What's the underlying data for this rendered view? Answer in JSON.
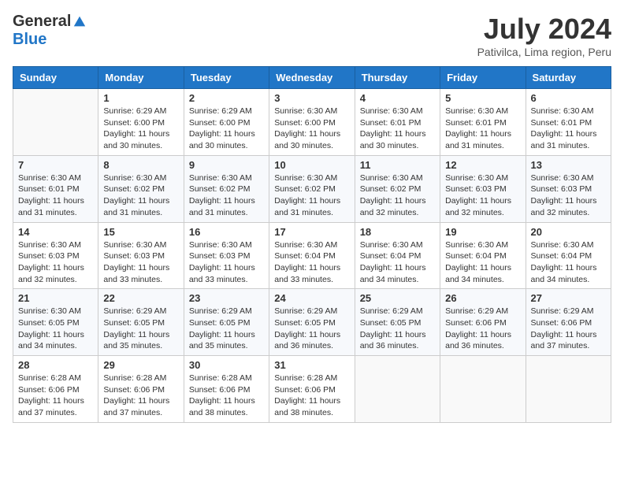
{
  "header": {
    "logo_general": "General",
    "logo_blue": "Blue",
    "month_title": "July 2024",
    "location": "Pativilca, Lima region, Peru"
  },
  "days_of_week": [
    "Sunday",
    "Monday",
    "Tuesday",
    "Wednesday",
    "Thursday",
    "Friday",
    "Saturday"
  ],
  "weeks": [
    [
      {
        "day": "",
        "sunrise": "",
        "sunset": "",
        "daylight": ""
      },
      {
        "day": "1",
        "sunrise": "Sunrise: 6:29 AM",
        "sunset": "Sunset: 6:00 PM",
        "daylight": "Daylight: 11 hours and 30 minutes."
      },
      {
        "day": "2",
        "sunrise": "Sunrise: 6:29 AM",
        "sunset": "Sunset: 6:00 PM",
        "daylight": "Daylight: 11 hours and 30 minutes."
      },
      {
        "day": "3",
        "sunrise": "Sunrise: 6:30 AM",
        "sunset": "Sunset: 6:00 PM",
        "daylight": "Daylight: 11 hours and 30 minutes."
      },
      {
        "day": "4",
        "sunrise": "Sunrise: 6:30 AM",
        "sunset": "Sunset: 6:01 PM",
        "daylight": "Daylight: 11 hours and 30 minutes."
      },
      {
        "day": "5",
        "sunrise": "Sunrise: 6:30 AM",
        "sunset": "Sunset: 6:01 PM",
        "daylight": "Daylight: 11 hours and 31 minutes."
      },
      {
        "day": "6",
        "sunrise": "Sunrise: 6:30 AM",
        "sunset": "Sunset: 6:01 PM",
        "daylight": "Daylight: 11 hours and 31 minutes."
      }
    ],
    [
      {
        "day": "7",
        "sunrise": "Sunrise: 6:30 AM",
        "sunset": "Sunset: 6:01 PM",
        "daylight": "Daylight: 11 hours and 31 minutes."
      },
      {
        "day": "8",
        "sunrise": "Sunrise: 6:30 AM",
        "sunset": "Sunset: 6:02 PM",
        "daylight": "Daylight: 11 hours and 31 minutes."
      },
      {
        "day": "9",
        "sunrise": "Sunrise: 6:30 AM",
        "sunset": "Sunset: 6:02 PM",
        "daylight": "Daylight: 11 hours and 31 minutes."
      },
      {
        "day": "10",
        "sunrise": "Sunrise: 6:30 AM",
        "sunset": "Sunset: 6:02 PM",
        "daylight": "Daylight: 11 hours and 31 minutes."
      },
      {
        "day": "11",
        "sunrise": "Sunrise: 6:30 AM",
        "sunset": "Sunset: 6:02 PM",
        "daylight": "Daylight: 11 hours and 32 minutes."
      },
      {
        "day": "12",
        "sunrise": "Sunrise: 6:30 AM",
        "sunset": "Sunset: 6:03 PM",
        "daylight": "Daylight: 11 hours and 32 minutes."
      },
      {
        "day": "13",
        "sunrise": "Sunrise: 6:30 AM",
        "sunset": "Sunset: 6:03 PM",
        "daylight": "Daylight: 11 hours and 32 minutes."
      }
    ],
    [
      {
        "day": "14",
        "sunrise": "Sunrise: 6:30 AM",
        "sunset": "Sunset: 6:03 PM",
        "daylight": "Daylight: 11 hours and 32 minutes."
      },
      {
        "day": "15",
        "sunrise": "Sunrise: 6:30 AM",
        "sunset": "Sunset: 6:03 PM",
        "daylight": "Daylight: 11 hours and 33 minutes."
      },
      {
        "day": "16",
        "sunrise": "Sunrise: 6:30 AM",
        "sunset": "Sunset: 6:03 PM",
        "daylight": "Daylight: 11 hours and 33 minutes."
      },
      {
        "day": "17",
        "sunrise": "Sunrise: 6:30 AM",
        "sunset": "Sunset: 6:04 PM",
        "daylight": "Daylight: 11 hours and 33 minutes."
      },
      {
        "day": "18",
        "sunrise": "Sunrise: 6:30 AM",
        "sunset": "Sunset: 6:04 PM",
        "daylight": "Daylight: 11 hours and 34 minutes."
      },
      {
        "day": "19",
        "sunrise": "Sunrise: 6:30 AM",
        "sunset": "Sunset: 6:04 PM",
        "daylight": "Daylight: 11 hours and 34 minutes."
      },
      {
        "day": "20",
        "sunrise": "Sunrise: 6:30 AM",
        "sunset": "Sunset: 6:04 PM",
        "daylight": "Daylight: 11 hours and 34 minutes."
      }
    ],
    [
      {
        "day": "21",
        "sunrise": "Sunrise: 6:30 AM",
        "sunset": "Sunset: 6:05 PM",
        "daylight": "Daylight: 11 hours and 34 minutes."
      },
      {
        "day": "22",
        "sunrise": "Sunrise: 6:29 AM",
        "sunset": "Sunset: 6:05 PM",
        "daylight": "Daylight: 11 hours and 35 minutes."
      },
      {
        "day": "23",
        "sunrise": "Sunrise: 6:29 AM",
        "sunset": "Sunset: 6:05 PM",
        "daylight": "Daylight: 11 hours and 35 minutes."
      },
      {
        "day": "24",
        "sunrise": "Sunrise: 6:29 AM",
        "sunset": "Sunset: 6:05 PM",
        "daylight": "Daylight: 11 hours and 36 minutes."
      },
      {
        "day": "25",
        "sunrise": "Sunrise: 6:29 AM",
        "sunset": "Sunset: 6:05 PM",
        "daylight": "Daylight: 11 hours and 36 minutes."
      },
      {
        "day": "26",
        "sunrise": "Sunrise: 6:29 AM",
        "sunset": "Sunset: 6:06 PM",
        "daylight": "Daylight: 11 hours and 36 minutes."
      },
      {
        "day": "27",
        "sunrise": "Sunrise: 6:29 AM",
        "sunset": "Sunset: 6:06 PM",
        "daylight": "Daylight: 11 hours and 37 minutes."
      }
    ],
    [
      {
        "day": "28",
        "sunrise": "Sunrise: 6:28 AM",
        "sunset": "Sunset: 6:06 PM",
        "daylight": "Daylight: 11 hours and 37 minutes."
      },
      {
        "day": "29",
        "sunrise": "Sunrise: 6:28 AM",
        "sunset": "Sunset: 6:06 PM",
        "daylight": "Daylight: 11 hours and 37 minutes."
      },
      {
        "day": "30",
        "sunrise": "Sunrise: 6:28 AM",
        "sunset": "Sunset: 6:06 PM",
        "daylight": "Daylight: 11 hours and 38 minutes."
      },
      {
        "day": "31",
        "sunrise": "Sunrise: 6:28 AM",
        "sunset": "Sunset: 6:06 PM",
        "daylight": "Daylight: 11 hours and 38 minutes."
      },
      {
        "day": "",
        "sunrise": "",
        "sunset": "",
        "daylight": ""
      },
      {
        "day": "",
        "sunrise": "",
        "sunset": "",
        "daylight": ""
      },
      {
        "day": "",
        "sunrise": "",
        "sunset": "",
        "daylight": ""
      }
    ]
  ]
}
